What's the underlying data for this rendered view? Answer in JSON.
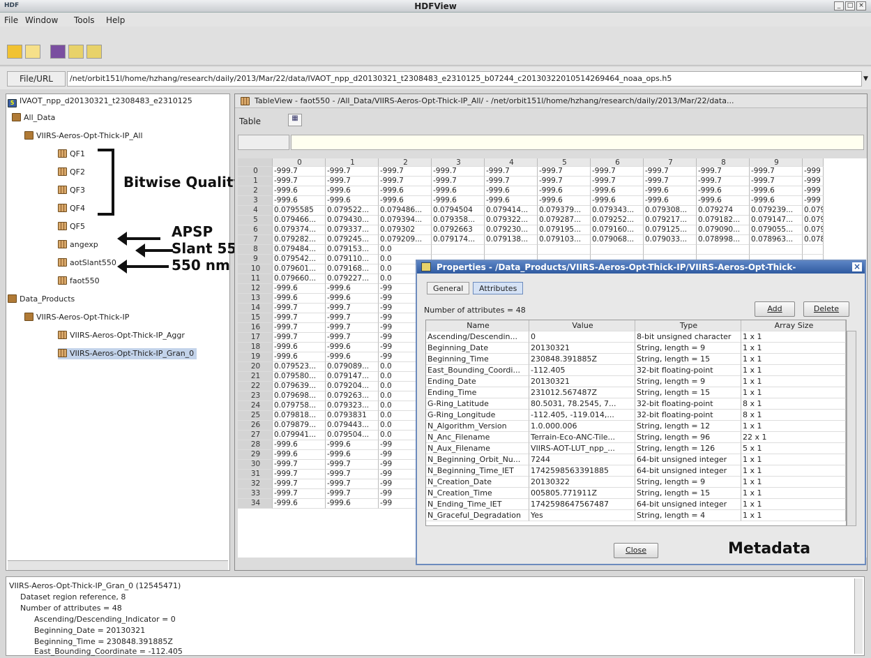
{
  "window": {
    "title": "HDFView",
    "logo": "HDF"
  },
  "menu": [
    "File",
    "Window",
    "Tools",
    "Help"
  ],
  "url": {
    "label": "File/URL",
    "value": "/net/orbit151l/home/hzhang/research/daily/2013/Mar/22/data/IVAOT_npp_d20130321_t2308483_e2310125_b07244_c20130322010514269464_noaa_ops.h5"
  },
  "tree": {
    "root": "IVAOT_npp_d20130321_t2308483_e2310125",
    "all_data": "All_Data",
    "group1": "VIIRS-Aeros-Opt-Thick-IP_All",
    "datasets": [
      "QF1",
      "QF2",
      "QF3",
      "QF4",
      "QF5",
      "angexp",
      "aotSlant550",
      "faot550"
    ],
    "data_products": "Data_Products",
    "group2": "VIIRS-Aeros-Opt-Thick-IP",
    "items2": [
      "VIIRS-Aeros-Opt-Thick-IP_Aggr",
      "VIIRS-Aeros-Opt-Thick-IP_Gran_0"
    ]
  },
  "annotations": {
    "flags": "Bitwise Quality Flags",
    "apsp": "APSP",
    "slant": "Slant 550 nm AOT",
    "aot": "550 nm AOT",
    "metadata": "Metadata"
  },
  "tableview": {
    "title": "TableView  -  faot550  -  /All_Data/VIIRS-Aeros-Opt-Thick-IP_All/  -  /net/orbit151l/home/hzhang/research/daily/2013/Mar/22/data...",
    "menu": "Table",
    "columns": [
      "0",
      "1",
      "2",
      "3",
      "4",
      "5",
      "6",
      "7",
      "8",
      "9",
      ""
    ],
    "rows": [
      [
        "-999.7",
        "-999.7",
        "-999.7",
        "-999.7",
        "-999.7",
        "-999.7",
        "-999.7",
        "-999.7",
        "-999.7",
        "-999.7",
        "-999"
      ],
      [
        "-999.7",
        "-999.7",
        "-999.7",
        "-999.7",
        "-999.7",
        "-999.7",
        "-999.7",
        "-999.7",
        "-999.7",
        "-999.7",
        "-999"
      ],
      [
        "-999.6",
        "-999.6",
        "-999.6",
        "-999.6",
        "-999.6",
        "-999.6",
        "-999.6",
        "-999.6",
        "-999.6",
        "-999.6",
        "-999"
      ],
      [
        "-999.6",
        "-999.6",
        "-999.6",
        "-999.6",
        "-999.6",
        "-999.6",
        "-999.6",
        "-999.6",
        "-999.6",
        "-999.6",
        "-999"
      ],
      [
        "0.0795585",
        "0.079522...",
        "0.079486...",
        "0.0794504",
        "0.079414...",
        "0.079379...",
        "0.079343...",
        "0.079308...",
        "0.079274",
        "0.079239...",
        "0.079"
      ],
      [
        "0.079466...",
        "0.079430...",
        "0.079394...",
        "0.079358...",
        "0.079322...",
        "0.079287...",
        "0.079252...",
        "0.079217...",
        "0.079182...",
        "0.079147...",
        "0.079"
      ],
      [
        "0.079374...",
        "0.079337...",
        "0.079302",
        "0.0792663",
        "0.079230...",
        "0.079195...",
        "0.079160...",
        "0.079125...",
        "0.079090...",
        "0.079055...",
        "0.079"
      ],
      [
        "0.079282...",
        "0.079245...",
        "0.079209...",
        "0.079174...",
        "0.079138...",
        "0.079103...",
        "0.079068...",
        "0.079033...",
        "0.078998...",
        "0.078963...",
        "0.078"
      ],
      [
        "0.079484...",
        "0.079153...",
        "0.0",
        "",
        "",
        "",
        "",
        "",
        "",
        "",
        ""
      ],
      [
        "0.079542...",
        "0.079110...",
        "0.0",
        "",
        "",
        "",
        "",
        "",
        "",
        "",
        ""
      ],
      [
        "0.079601...",
        "0.079168...",
        "0.0",
        "",
        "",
        "",
        "",
        "",
        "",
        "",
        ""
      ],
      [
        "0.079660...",
        "0.079227...",
        "0.0",
        "",
        "",
        "",
        "",
        "",
        "",
        "",
        ""
      ],
      [
        "-999.6",
        "-999.6",
        "-99",
        "",
        "",
        "",
        "",
        "",
        "",
        "",
        ""
      ],
      [
        "-999.6",
        "-999.6",
        "-99",
        "",
        "",
        "",
        "",
        "",
        "",
        "",
        ""
      ],
      [
        "-999.7",
        "-999.7",
        "-99",
        "",
        "",
        "",
        "",
        "",
        "",
        "",
        ""
      ],
      [
        "-999.7",
        "-999.7",
        "-99",
        "",
        "",
        "",
        "",
        "",
        "",
        "",
        ""
      ],
      [
        "-999.7",
        "-999.7",
        "-99",
        "",
        "",
        "",
        "",
        "",
        "",
        "",
        ""
      ],
      [
        "-999.7",
        "-999.7",
        "-99",
        "",
        "",
        "",
        "",
        "",
        "",
        "",
        ""
      ],
      [
        "-999.6",
        "-999.6",
        "-99",
        "",
        "",
        "",
        "",
        "",
        "",
        "",
        ""
      ],
      [
        "-999.6",
        "-999.6",
        "-99",
        "",
        "",
        "",
        "",
        "",
        "",
        "",
        ""
      ],
      [
        "0.079523...",
        "0.079089...",
        "0.0",
        "",
        "",
        "",
        "",
        "",
        "",
        "",
        ""
      ],
      [
        "0.079580...",
        "0.079147...",
        "0.0",
        "",
        "",
        "",
        "",
        "",
        "",
        "",
        ""
      ],
      [
        "0.079639...",
        "0.079204...",
        "0.0",
        "",
        "",
        "",
        "",
        "",
        "",
        "",
        ""
      ],
      [
        "0.079698...",
        "0.079263...",
        "0.0",
        "",
        "",
        "",
        "",
        "",
        "",
        "",
        ""
      ],
      [
        "0.079758...",
        "0.079323...",
        "0.0",
        "",
        "",
        "",
        "",
        "",
        "",
        "",
        ""
      ],
      [
        "0.079818...",
        "0.0793831",
        "0.0",
        "",
        "",
        "",
        "",
        "",
        "",
        "",
        ""
      ],
      [
        "0.079879...",
        "0.079443...",
        "0.0",
        "",
        "",
        "",
        "",
        "",
        "",
        "",
        ""
      ],
      [
        "0.079941...",
        "0.079504...",
        "0.0",
        "",
        "",
        "",
        "",
        "",
        "",
        "",
        ""
      ],
      [
        "-999.6",
        "-999.6",
        "-99",
        "",
        "",
        "",
        "",
        "",
        "",
        "",
        ""
      ],
      [
        "-999.6",
        "-999.6",
        "-99",
        "",
        "",
        "",
        "",
        "",
        "",
        "",
        ""
      ],
      [
        "-999.7",
        "-999.7",
        "-99",
        "",
        "",
        "",
        "",
        "",
        "",
        "",
        ""
      ],
      [
        "-999.7",
        "-999.7",
        "-99",
        "",
        "",
        "",
        "",
        "",
        "",
        "",
        ""
      ],
      [
        "-999.7",
        "-999.7",
        "-99",
        "",
        "",
        "",
        "",
        "",
        "",
        "",
        ""
      ],
      [
        "-999.7",
        "-999.7",
        "-99",
        "",
        "",
        "",
        "",
        "",
        "",
        "",
        ""
      ],
      [
        "-999.6",
        "-999.6",
        "-99",
        "",
        "",
        "",
        "",
        "",
        "",
        "",
        ""
      ]
    ]
  },
  "properties": {
    "title": "Properties - /Data_Products/VIIRS-Aeros-Opt-Thick-IP/VIIRS-Aeros-Opt-Thick-",
    "tabs": [
      "General",
      "Attributes"
    ],
    "count_label": "Number of attributes = 48",
    "add": "Add",
    "delete": "Delete",
    "close": "Close",
    "headers": [
      "Name",
      "Value",
      "Type",
      "Array Size"
    ],
    "attrs": [
      [
        "Ascending/Descendin...",
        "0",
        "8-bit unsigned character",
        "1 x 1"
      ],
      [
        "Beginning_Date",
        "20130321",
        "String, length = 9",
        "1 x 1"
      ],
      [
        "Beginning_Time",
        "230848.391885Z",
        "String, length = 15",
        "1 x 1"
      ],
      [
        "East_Bounding_Coordi...",
        "-112.405",
        "32-bit floating-point",
        "1 x 1"
      ],
      [
        "Ending_Date",
        "20130321",
        "String, length = 9",
        "1 x 1"
      ],
      [
        "Ending_Time",
        "231012.567487Z",
        "String, length = 15",
        "1 x 1"
      ],
      [
        "G-Ring_Latitude",
        "80.5031, 78.2545, 7...",
        "32-bit floating-point",
        "8 x 1"
      ],
      [
        "G-Ring_Longitude",
        "-112.405, -119.014,...",
        "32-bit floating-point",
        "8 x 1"
      ],
      [
        "N_Algorithm_Version",
        "1.0.000.006",
        "String, length = 12",
        "1 x 1"
      ],
      [
        "N_Anc_Filename",
        "Terrain-Eco-ANC-Tile...",
        "String, length = 96",
        "22 x 1"
      ],
      [
        "N_Aux_Filename",
        "VIIRS-AOT-LUT_npp_...",
        "String, length = 126",
        "5 x 1"
      ],
      [
        "N_Beginning_Orbit_Nu...",
        "7244",
        "64-bit unsigned integer",
        "1 x 1"
      ],
      [
        "N_Beginning_Time_IET",
        "1742598563391885",
        "64-bit unsigned integer",
        "1 x 1"
      ],
      [
        "N_Creation_Date",
        "20130322",
        "String, length = 9",
        "1 x 1"
      ],
      [
        "N_Creation_Time",
        "005805.771911Z",
        "String, length = 15",
        "1 x 1"
      ],
      [
        "N_Ending_Time_IET",
        "1742598647567487",
        "64-bit unsigned integer",
        "1 x 1"
      ],
      [
        "N_Graceful_Degradation",
        "Yes",
        "String, length = 4",
        "1 x 1"
      ]
    ]
  },
  "bottom": [
    "VIIRS-Aeros-Opt-Thick-IP_Gran_0 (12545471)",
    "Dataset region reference,   8",
    "Number of attributes = 48",
    "Ascending/Descending_Indicator = 0",
    "Beginning_Date = 20130321",
    "Beginning_Time = 230848.391885Z",
    "East_Bounding_Coordinate = -112.405"
  ]
}
